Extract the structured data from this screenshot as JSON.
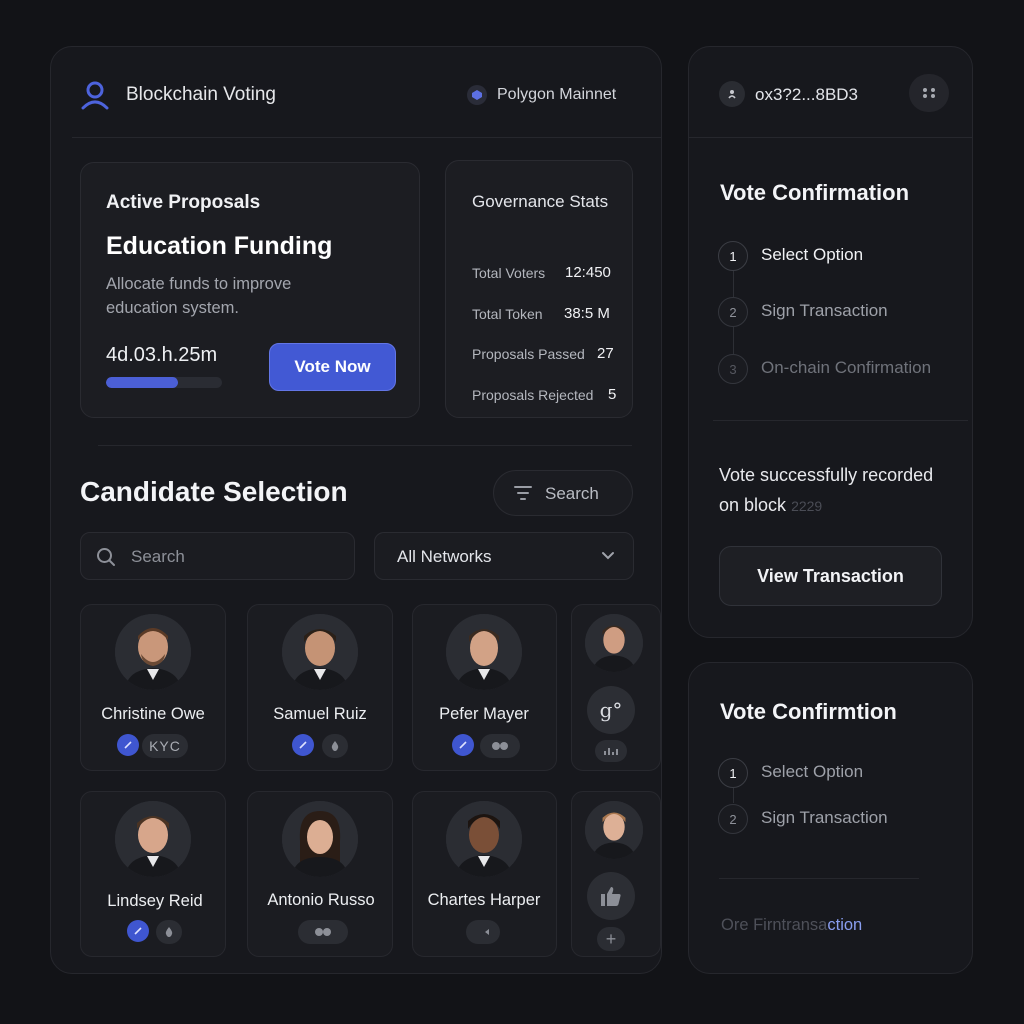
{
  "header": {
    "app_title": "Blockchain Voting",
    "network": "Polygon Mainnet"
  },
  "proposal": {
    "kicker": "Active Proposals",
    "title": "Education Funding",
    "description": "Allocate funds to improve education system.",
    "countdown": "4d.03.h.25m",
    "progress_percent": 62,
    "vote_button": "Vote Now"
  },
  "stats": {
    "title": "Governance Stats",
    "items": [
      {
        "label": "Total Voters",
        "value": "12:450"
      },
      {
        "label": "Total Token",
        "value": "38:5 M"
      },
      {
        "label": "Proposals Passed",
        "value": "27"
      },
      {
        "label": "Proposals Rejected",
        "value": "5"
      }
    ]
  },
  "candidates_section": {
    "title": "Candidate Selection",
    "filter_label": "Search",
    "search_placeholder": "Search",
    "network_select": "All Networks"
  },
  "candidates": [
    {
      "name": "Christine Owe",
      "badge": "KYC"
    },
    {
      "name": "Samuel Ruiz"
    },
    {
      "name": "Pefer Mayer"
    },
    {
      "name": "Lindsey Reid"
    },
    {
      "name": "Antonio Russo"
    },
    {
      "name": "Chartes Harper"
    }
  ],
  "wallet": {
    "address": "ox3?2...8BD3"
  },
  "confirmation": {
    "title": "Vote Confirmation",
    "steps": [
      {
        "num": "1",
        "label": "Select Option"
      },
      {
        "num": "2",
        "label": "Sign Transaction"
      },
      {
        "num": "3",
        "label": "On-chain Confirmation"
      }
    ],
    "success_message": "Vote successfully recorded on block",
    "block_number": "2229",
    "view_button": "View Transaction"
  },
  "confirmation2": {
    "title": "Vote Confirmtion",
    "steps": [
      {
        "num": "1",
        "label": "Select Option"
      },
      {
        "num": "2",
        "label": "Sign Transaction"
      }
    ],
    "footer_text": "Ore Firntransa",
    "footer_accent": "ction"
  },
  "colors": {
    "accent": "#4259d4",
    "background": "#121317",
    "panel": "#17181d"
  }
}
